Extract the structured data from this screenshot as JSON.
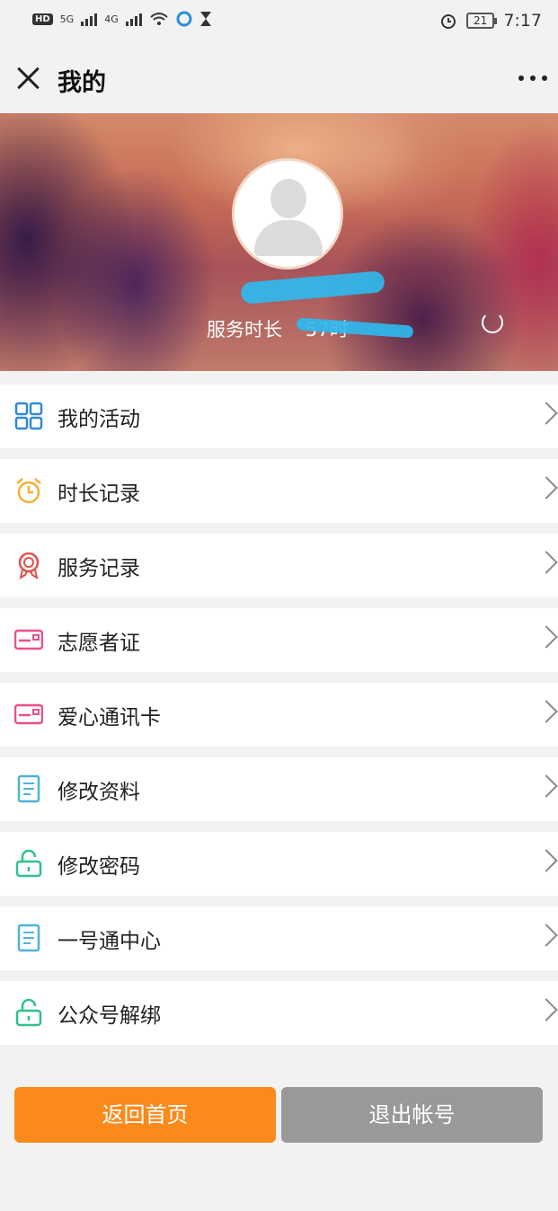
{
  "status_bar": {
    "network1": "5G",
    "network2": "4G",
    "battery": "21",
    "time": "7:17",
    "hd": "HD"
  },
  "title_bar": {
    "title": "我的"
  },
  "profile": {
    "service_label": "服务时长",
    "service_value": "57时"
  },
  "menu": [
    {
      "label": "我的活动",
      "icon": "grid-icon",
      "color": "#2f89d9"
    },
    {
      "label": "时长记录",
      "icon": "alarm-clock-icon",
      "color": "#f2b233"
    },
    {
      "label": "服务记录",
      "icon": "award-ribbon-icon",
      "color": "#e0524c"
    },
    {
      "label": "志愿者证",
      "icon": "id-card-icon",
      "color": "#e94f8a"
    },
    {
      "label": "爱心通讯卡",
      "icon": "id-card-icon",
      "color": "#e94f8a"
    },
    {
      "label": "修改资料",
      "icon": "document-icon",
      "color": "#4fb3d9"
    },
    {
      "label": "修改密码",
      "icon": "unlock-icon",
      "color": "#2fc28a"
    },
    {
      "label": "一号通中心",
      "icon": "document-icon",
      "color": "#4fb3d9"
    },
    {
      "label": "公众号解绑",
      "icon": "unlock-icon",
      "color": "#2fc28a"
    }
  ],
  "buttons": {
    "home": "返回首页",
    "logout": "退出帐号"
  }
}
